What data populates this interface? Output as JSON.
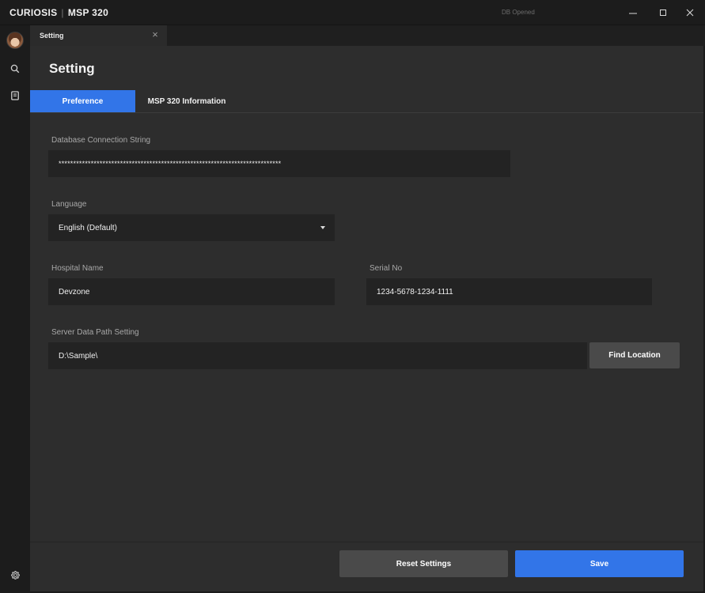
{
  "app": {
    "brand": "CURIOSIS",
    "product": "MSP 320",
    "db_status": "DB Opened"
  },
  "window_controls": {
    "minimize_icon": "minimize-icon",
    "maximize_icon": "maximize-icon",
    "close_icon": "close-icon"
  },
  "sidebar": {
    "items": [
      {
        "icon": "avatar"
      },
      {
        "icon": "search-icon"
      },
      {
        "icon": "document-icon"
      },
      {
        "icon": "gear-icon"
      }
    ]
  },
  "tabs": {
    "open_tab": "Setting"
  },
  "page": {
    "title": "Setting",
    "subtabs": [
      "Preference",
      "MSP 320 Information"
    ],
    "active_subtab": "Preference"
  },
  "form": {
    "db_label": "Database Connection String",
    "db_value": "****************************************************************************",
    "language_label": "Language",
    "language_value": "English (Default)",
    "hospital_label": "Hospital Name",
    "hospital_value": "Devzone",
    "serial_label": "Serial No",
    "serial_value": "1234-5678-1234-1111",
    "path_label": "Server Data Path Setting",
    "path_value": "D:\\Sample\\",
    "find_location": "Find Location"
  },
  "actions": {
    "reset": "Reset Settings",
    "save": "Save"
  },
  "colors": {
    "accent": "#3275e8",
    "background": "#2d2d2d",
    "field": "#232323"
  }
}
